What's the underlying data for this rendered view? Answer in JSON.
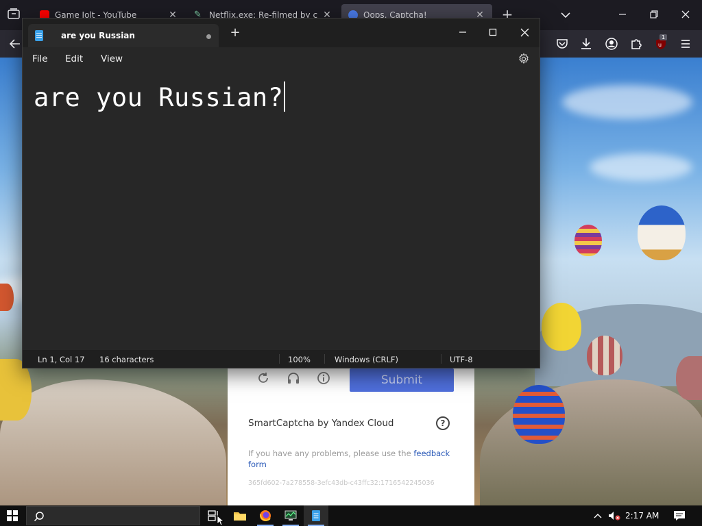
{
  "browser": {
    "tabs": [
      {
        "title": "Game Jolt - YouTube",
        "favicon": "youtube-icon",
        "color": "#ff0000"
      },
      {
        "title": "Netflix.exe: Re-filmed by catgirl",
        "favicon": "pen-icon",
        "color": "#7fd1a8"
      },
      {
        "title": "Oops, Captcha!",
        "favicon": "captcha-icon",
        "color": "#4a7be8"
      }
    ],
    "new_tab_label": "+",
    "extension_badge": "1"
  },
  "notepad": {
    "tab_title": "are you Russian",
    "new_tab_label": "+",
    "menus": [
      "File",
      "Edit",
      "View"
    ],
    "text": "are you Russian?",
    "status": {
      "position": "Ln 1, Col 17",
      "characters": "16 characters",
      "zoom": "100%",
      "line_ending": "Windows (CRLF)",
      "encoding": "UTF-8"
    }
  },
  "captcha": {
    "submit_label": "Submit",
    "brand": "SmartCaptcha by Yandex Cloud",
    "help_label": "?",
    "problem_text": "If you have any problems, please use the ",
    "feedback_link": "feedback form",
    "session_id": "365fd602-7a278558-3efc43db-c43ffc32:1716542245036"
  },
  "taskbar": {
    "clock": "2:17 AM",
    "apps": [
      "task-view",
      "file-explorer",
      "firefox",
      "monitor",
      "notepad"
    ]
  },
  "colors": {
    "notepad_bg": "#272727",
    "notepad_titlebar": "#1f1f1f",
    "browser_chrome": "#2b2a33",
    "captcha_submit": "#4f6fdc",
    "taskbar": "#101010"
  }
}
